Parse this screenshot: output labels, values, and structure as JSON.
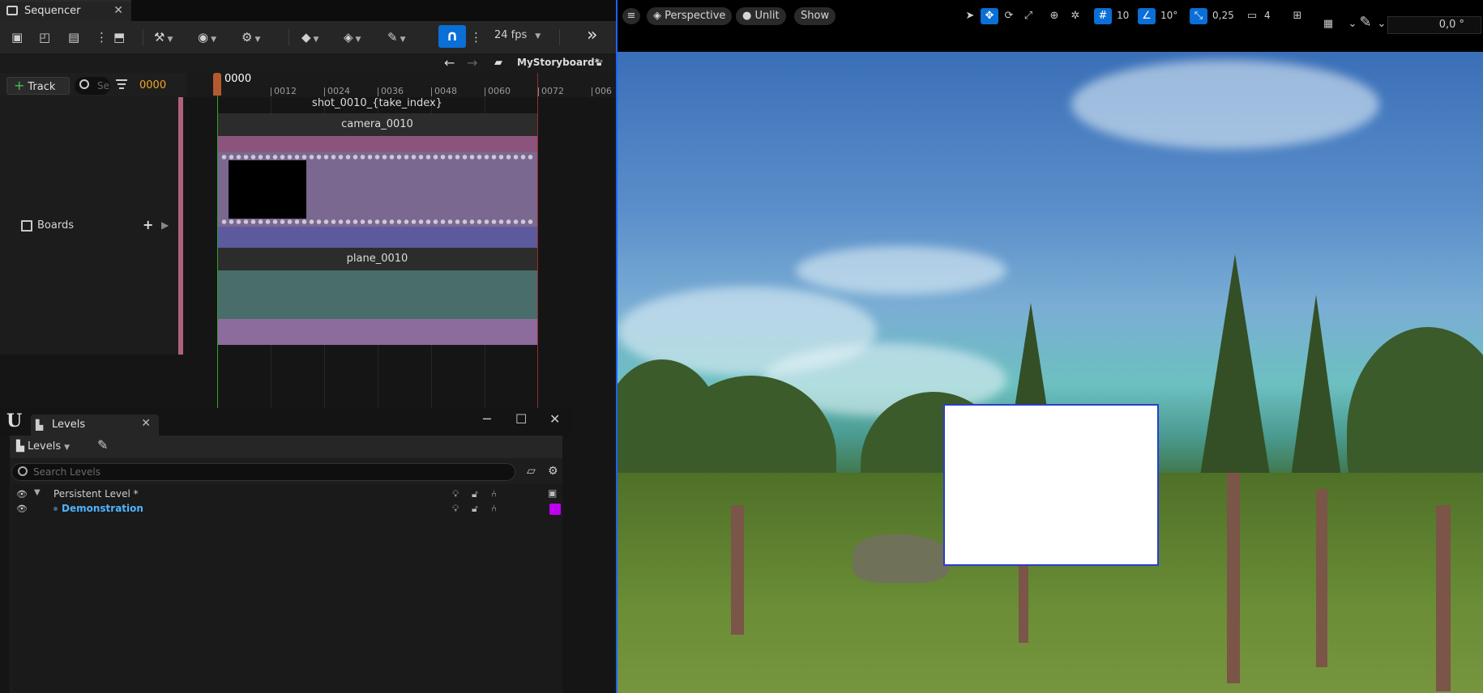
{
  "sequencer": {
    "tab_title": "Sequencer",
    "fps": "24 fps",
    "breadcrumb": "MyStoryboard*",
    "add_track_label": "Track",
    "search_placeholder": "Se",
    "current_frame": "0000",
    "playhead_label": "0000",
    "ruler_labels": [
      "0012",
      "0024",
      "0036",
      "0048",
      "0060",
      "0072",
      "006"
    ],
    "outliner_row": "Boards",
    "shot_label": "shot_0010_{take_index}",
    "camera_track": "camera_0010",
    "plane_track": "plane_0010"
  },
  "levels": {
    "tab_title": "Levels",
    "dropdown_label": "Levels",
    "search_placeholder": "Search Levels",
    "rows": [
      {
        "name": "Persistent Level *",
        "active": false
      },
      {
        "name": "Demonstration",
        "active": true,
        "color": "#c000f0"
      }
    ]
  },
  "viewport": {
    "perspective_label": "Perspective",
    "unlit_label": "Unlit",
    "show_label": "Show",
    "grid_snap": "10",
    "rotation_snap": "10°",
    "scale_snap": "0,25",
    "camera_speed": "4",
    "fov_value": "0,0 °"
  },
  "colors": {
    "accent_blue": "#0a6fd6",
    "frame_orange": "#f5a623",
    "camera_track": "#7a6890",
    "plane_track": "#496d6a",
    "level_color": "#c000f0"
  }
}
